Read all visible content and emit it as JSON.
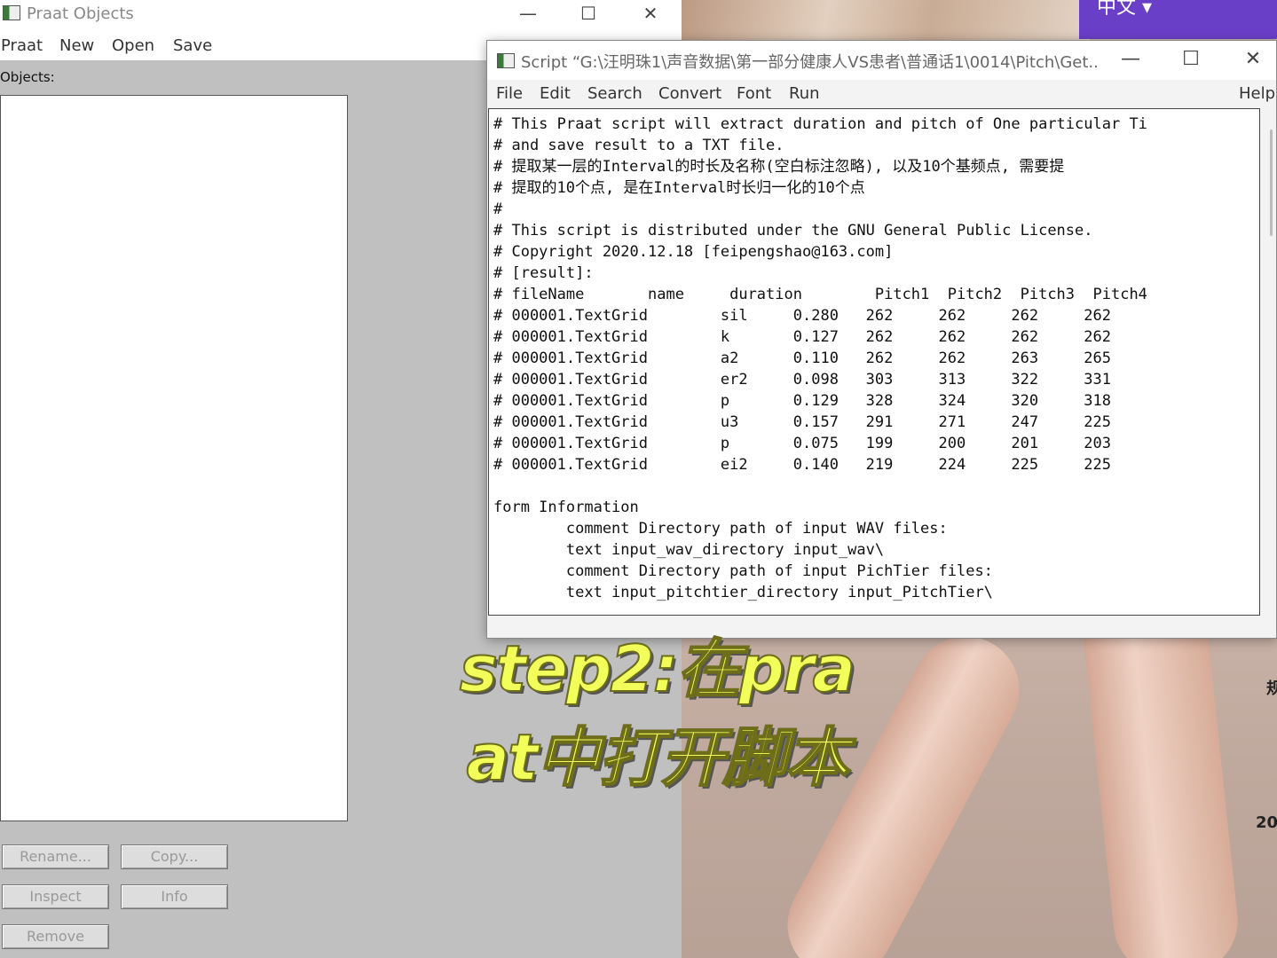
{
  "praat_objects": {
    "title": "Praat Objects",
    "menu": [
      "Praat",
      "New",
      "Open",
      "Save"
    ],
    "objects_label": "Objects:",
    "buttons": {
      "rename": "Rename...",
      "copy": "Copy...",
      "inspect": "Inspect",
      "info": "Info",
      "remove": "Remove"
    }
  },
  "window_controls": {
    "minimize": "—",
    "maximize": "☐",
    "close": "✕"
  },
  "script_window": {
    "title": "Script “G:\\汪明珠1\\声音数据\\第一部分健康人VS患者\\普通话1\\0014\\Pitch\\Get...",
    "menu": [
      "File",
      "Edit",
      "Search",
      "Convert",
      "Font",
      "Run",
      "Help"
    ],
    "code_lines": [
      "# This Praat script will extract duration and pitch of One particular Ti",
      "# and save result to a TXT file.",
      "# 提取某一层的Interval的时长及名称(空白标注忽略), 以及10个基频点, 需要提",
      "# 提取的10个点, 是在Interval时长归一化的10个点",
      "#",
      "# This script is distributed under the GNU General Public License.",
      "# Copyright 2020.12.18 [feipengshao@163.com]",
      "# [result]:",
      "# fileName       name     duration        Pitch1  Pitch2  Pitch3  Pitch4",
      "# 000001.TextGrid        sil     0.280   262     262     262     262",
      "# 000001.TextGrid        k       0.127   262     262     262     262",
      "# 000001.TextGrid        a2      0.110   262     262     263     265",
      "# 000001.TextGrid        er2     0.098   303     313     322     331",
      "# 000001.TextGrid        p       0.129   328     324     320     318",
      "# 000001.TextGrid        u3      0.157   291     271     247     225",
      "# 000001.TextGrid        p       0.075   199     200     201     203",
      "# 000001.TextGrid        ei2     0.140   219     224     225     225",
      "",
      "form Information",
      "        comment Directory path of input WAV files:",
      "        text input_wav_directory input_wav\\",
      "        comment Directory path of input PichTier files:",
      "        text input_pitchtier_directory input_PitchTier\\"
    ]
  },
  "desktop": {
    "ime_label": "中文 ▾",
    "side_text_1": "规",
    "side_text_2": "20"
  },
  "caption": {
    "line1": "step2:在pra",
    "line2": "at中打开脚本"
  }
}
